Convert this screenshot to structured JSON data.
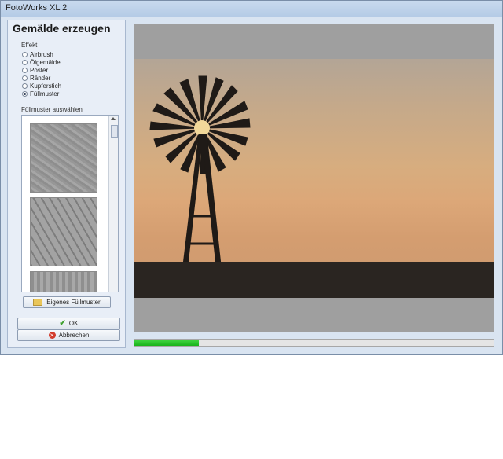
{
  "window": {
    "title": "FotoWorks XL 2"
  },
  "panel": {
    "heading": "Gemälde erzeugen",
    "effect_group_label": "Effekt",
    "effects": [
      {
        "label": "Airbrush",
        "checked": false
      },
      {
        "label": "Ölgemälde",
        "checked": false
      },
      {
        "label": "Poster",
        "checked": false
      },
      {
        "label": "Ränder",
        "checked": false
      },
      {
        "label": "Kupferstich",
        "checked": false
      },
      {
        "label": "Füllmuster",
        "checked": true
      }
    ],
    "pattern_group_label": "Füllmuster auswählen",
    "custom_pattern_button": "Eigenes Füllmuster",
    "ok_button": "OK",
    "cancel_button": "Abbrechen"
  },
  "progress": {
    "fraction": 0.18,
    "color": "#18b31b"
  },
  "icons": {
    "ok": "checkmark-icon",
    "cancel": "cancel-circle-icon",
    "folder": "folder-icon"
  }
}
